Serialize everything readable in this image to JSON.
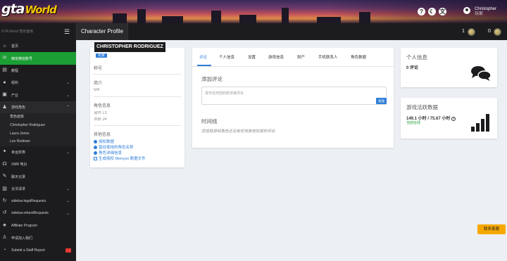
{
  "header": {
    "logo_main": "gta",
    "logo_sub": "World",
    "user": "Christopher",
    "user_sub": "玩家",
    "icons": [
      "help-icon",
      "moon-icon",
      "translate-icon"
    ]
  },
  "navbar": {
    "sidebar_title": "GTA World 角色面板",
    "page_title": "Character Profile",
    "count1": "1",
    "count2": "0"
  },
  "sidebar": {
    "items": [
      {
        "label": "首页",
        "icon": "home-icon"
      },
      {
        "label": "绑定微信账号",
        "icon": "wechat-icon"
      },
      {
        "label": "教程",
        "icon": "book-icon"
      },
      {
        "label": "组织",
        "icon": "group-icon"
      },
      {
        "label": "产业",
        "icon": "briefcase-icon"
      },
      {
        "label": "游戏角色",
        "icon": "user-icon"
      }
    ],
    "sub": [
      "角色面板",
      "Christopher Rodriguez",
      "Laura Jones",
      "Leo Rodman"
    ],
    "items2": [
      {
        "label": "幸运奖券",
        "icon": "ticket-icon"
      },
      {
        "label": "XMR 电台",
        "icon": "radio-icon"
      },
      {
        "label": "聊天记录",
        "icon": "chat-icon"
      },
      {
        "label": "合法请求",
        "icon": "building-icon"
      },
      {
        "label": "sidebar.legalRequests",
        "icon": "refresh-icon"
      },
      {
        "label": "sidebar.refundRequests",
        "icon": "refund-icon"
      },
      {
        "label": "Affiliate Program",
        "icon": "star-icon"
      },
      {
        "label": "申请加入我们",
        "icon": "user-plus-icon"
      },
      {
        "label": "Submit a Staff Report",
        "icon": "report-icon"
      }
    ]
  },
  "character": {
    "name": "CHRISTOPHER RODRIGUEZ",
    "tag": "玩家",
    "title_label": "称号",
    "bio_label": "简介",
    "bio_value": "N/A",
    "info_label": "角色信息",
    "city": "城市: LS",
    "age": "年龄: 24",
    "other_label": "其他信息",
    "links": [
      "授权数据",
      "曾经使用的角色名称",
      "角色详细信息",
      "生成授权 Menyoo 数据文件"
    ]
  },
  "tabs": [
    "评论",
    "个人信息",
    "设置",
    "游戏信息",
    "财产",
    "手机联系人",
    "角色数据"
  ],
  "comments": {
    "add_title": "添加评论",
    "placeholder": "发布任何您的想法或评论",
    "send": "发送",
    "timeline_title": "时间线",
    "empty": "您选取游戏角色还没有任何其他玩家的评论"
  },
  "personal": {
    "title": "个人信息",
    "comments": "0 评论"
  },
  "stats": {
    "title": "游戏活跃数据",
    "hours": "149.1 小时 / 75.67 小时",
    "status": "当前在线"
  },
  "contact": "联系客服",
  "colors": {
    "accent": "#2f7fd8",
    "active": "#1b9e34",
    "dark": "#1c1c1e",
    "contact": "#f7a800"
  }
}
